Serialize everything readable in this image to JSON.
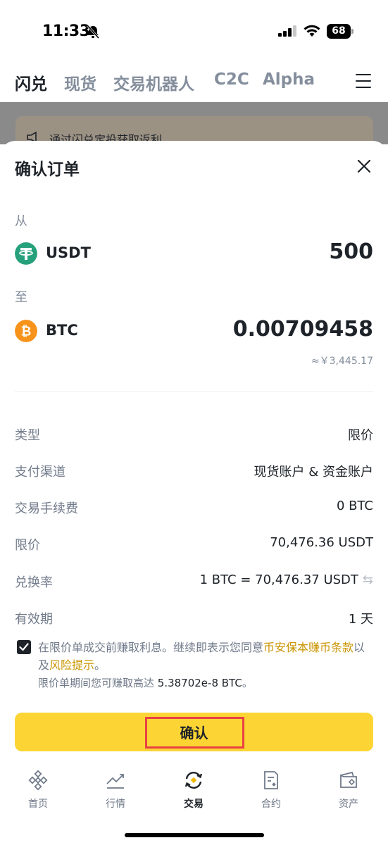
{
  "status_bar": {
    "time": "11:33",
    "battery": "68"
  },
  "top_tabs": [
    {
      "label": "闪兑",
      "active": true
    },
    {
      "label": "现货",
      "active": false
    },
    {
      "label": "交易机器人",
      "active": false
    },
    {
      "label": "C2C",
      "active": false
    },
    {
      "label": "Alpha",
      "active": false
    }
  ],
  "promo": {
    "text": "通过闪兑定投获取返利"
  },
  "sheet": {
    "title": "确认订单",
    "from_label": "从",
    "to_label": "至",
    "from": {
      "coin": "USDT",
      "amount": "500",
      "logo_color": "#26a17b"
    },
    "to": {
      "coin": "BTC",
      "amount": "0.00709458",
      "logo_color": "#f7931a",
      "fiat": "≈￥3,445.17"
    }
  },
  "details": [
    {
      "label": "类型",
      "value": "限价"
    },
    {
      "label": "支付渠道",
      "value": "现货账户 & 资金账户"
    },
    {
      "label": "交易手续费",
      "value": "0 BTC"
    },
    {
      "label": "限价",
      "value": "70,476.36 USDT"
    },
    {
      "label": "兑换率",
      "value": "1 BTC = 70,476.37 USDT",
      "icon": "swap-arrows-icon"
    },
    {
      "label": "有效期",
      "value": "1 天"
    }
  ],
  "consent": {
    "checked": true,
    "text_a": "在限价单成交前赚取利息。继续即表示您同意",
    "link_terms": "币安保本赚币条款",
    "text_b": "以及",
    "link_risk": "风险提示",
    "text_c": "。",
    "earn_prefix": "限价单期间您可赚取高达 ",
    "earn_amount": "5.38702e-8 BTC",
    "earn_suffix": "。"
  },
  "confirm_label": "确认",
  "bottom_nav": [
    {
      "label": "首页",
      "icon": "home-icon",
      "active": false
    },
    {
      "label": "行情",
      "icon": "markets-icon",
      "active": false
    },
    {
      "label": "交易",
      "icon": "trade-icon",
      "active": true
    },
    {
      "label": "合约",
      "icon": "futures-icon",
      "active": false
    },
    {
      "label": "资产",
      "icon": "wallet-icon",
      "active": false
    }
  ],
  "colors": {
    "accent": "#fcd535",
    "link": "#c99400",
    "highlight": "#e84142",
    "text_primary": "#1e2329",
    "text_secondary": "#707a8a"
  }
}
